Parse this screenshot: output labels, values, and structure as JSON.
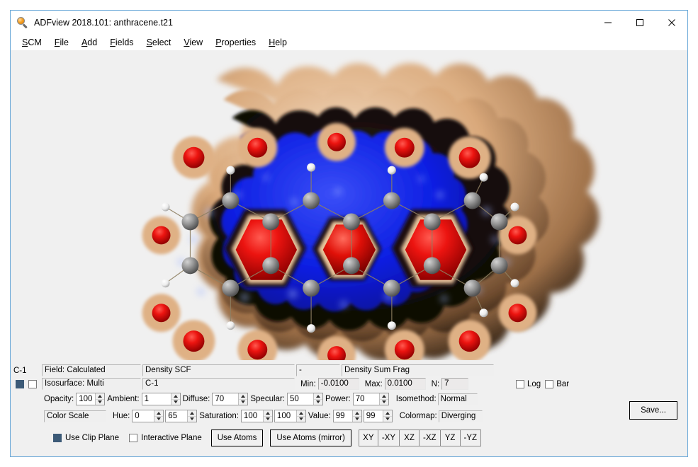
{
  "window": {
    "title": "ADFview 2018.101: anthracene.t21",
    "icon": "magnifier-icon",
    "minimize_label": "—",
    "maximize_label": "□",
    "close_label": "✕"
  },
  "menu": {
    "items": [
      {
        "label": "SCM",
        "mnemonic": "S"
      },
      {
        "label": "File",
        "mnemonic": "F"
      },
      {
        "label": "Add",
        "mnemonic": "A"
      },
      {
        "label": "Fields",
        "mnemonic": "F"
      },
      {
        "label": "Select",
        "mnemonic": "S"
      },
      {
        "label": "View",
        "mnemonic": "V"
      },
      {
        "label": "Properties",
        "mnemonic": "P"
      },
      {
        "label": "Help",
        "mnemonic": "H"
      }
    ]
  },
  "viewport": {
    "background": "#f0f0f0",
    "molecule": "anthracene",
    "isosurface_outer_color": "#d8a87c",
    "isosurface_inner_color": "#0a1ae0",
    "isosurface_core_color": "#d80000",
    "carbon_color": "#8a8a8a",
    "hydrogen_color": "#f2f2f2"
  },
  "panel": {
    "row_field": {
      "surface_label": "C-1",
      "field_label": "Field: Calculated",
      "field_value": "Density SCF",
      "dash": "-",
      "fragment_value": "Density Sum Frag"
    },
    "row_isosurface": {
      "isosurface_label": "Isosurface: Multi",
      "isosurface_value": "C-1",
      "min_label": "Min:",
      "min_value": "-0.0100",
      "max_label": "Max:",
      "max_value": "0.0100",
      "n_label": "N:",
      "n_value": "7",
      "log_label": "Log",
      "log_checked": false,
      "bar_label": "Bar",
      "bar_checked": false,
      "visible_checked": true,
      "second_checked": false
    },
    "row_material": {
      "opacity_label": "Opacity:",
      "opacity_value": "100",
      "ambient_label": "Ambient:",
      "ambient_value": "1",
      "diffuse_label": "Diffuse:",
      "diffuse_value": "70",
      "specular_label": "Specular:",
      "specular_value": "50",
      "power_label": "Power:",
      "power_value": "70",
      "isomethod_label": "Isomethod:",
      "isomethod_value": "Normal"
    },
    "row_colorscale": {
      "title": "Color Scale",
      "hue_label": "Hue:",
      "hue_min": "0",
      "hue_max": "65",
      "saturation_label": "Saturation:",
      "saturation_min": "100",
      "saturation_max": "100",
      "value_label": "Value:",
      "value_min": "99",
      "value_max": "99",
      "colormap_label": "Colormap:",
      "colormap_value": "Diverging"
    },
    "row_buttons": {
      "use_clip_plane_label": "Use Clip Plane",
      "use_clip_plane_checked": true,
      "interactive_plane_label": "Interactive Plane",
      "interactive_plane_checked": false,
      "use_atoms_label": "Use Atoms",
      "use_atoms_mirror_label": "Use Atoms (mirror)",
      "axis_buttons": [
        "XY",
        "-XY",
        "XZ",
        "-XZ",
        "YZ",
        "-YZ"
      ]
    },
    "save_label": "Save..."
  }
}
